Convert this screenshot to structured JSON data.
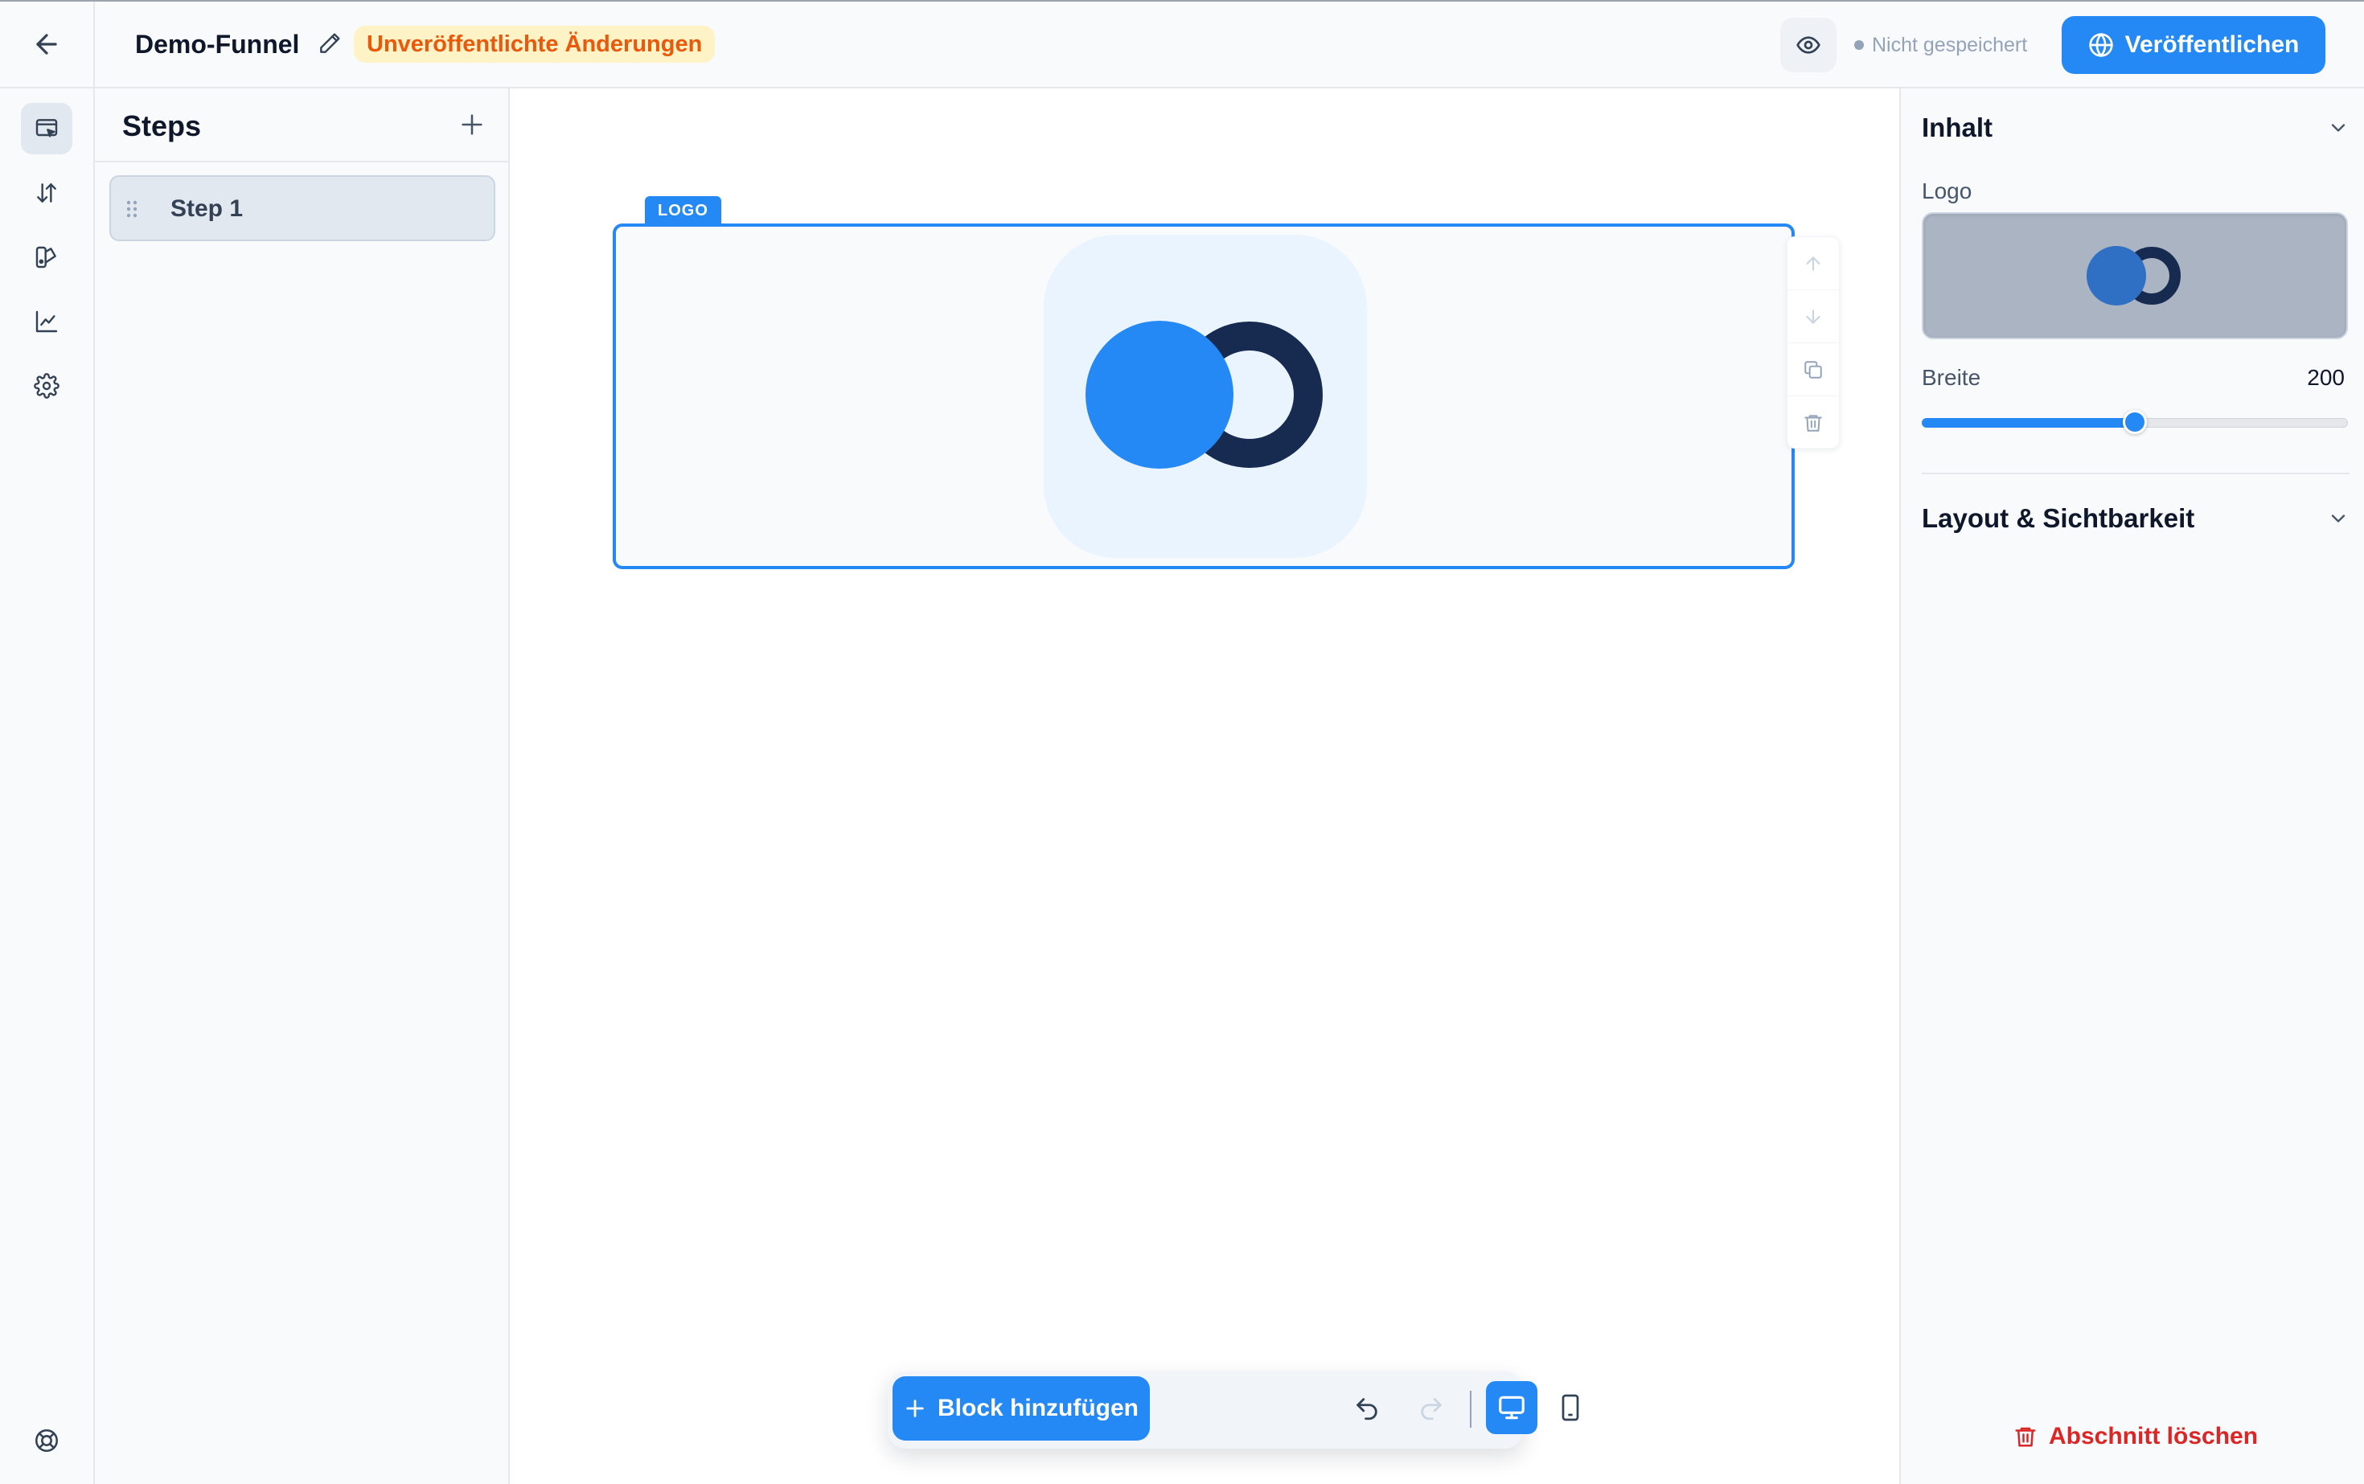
{
  "header": {
    "funnel_name": "Demo-Funnel",
    "unpublished_badge": "Unveröffentlichte Änderungen",
    "save_status": "Nicht gespeichert",
    "publish_label": "Veröffentlichen",
    "icons": {
      "back": "arrow-left-icon",
      "rename": "pencil-icon",
      "preview": "eye-icon",
      "publish": "globe-icon"
    }
  },
  "rail": {
    "items": [
      {
        "icon": "page-editor-icon",
        "active": true
      },
      {
        "icon": "sort-arrows-icon",
        "active": false
      },
      {
        "icon": "design-palette-icon",
        "active": false
      },
      {
        "icon": "analytics-chart-icon",
        "active": false
      },
      {
        "icon": "settings-gear-icon",
        "active": false
      }
    ],
    "bottom_icon": "help-lifebuoy-icon"
  },
  "steps": {
    "title": "Steps",
    "add_icon": "plus-icon",
    "items": [
      {
        "label": "Step 1",
        "selected": true
      }
    ]
  },
  "canvas": {
    "selected_block_tag": "LOGO",
    "block_tools": [
      "arrow-up-icon",
      "arrow-down-icon",
      "duplicate-icon",
      "trash-icon"
    ],
    "toolbar": {
      "add_block_label": "Block hinzufügen",
      "undo_icon": "undo-icon",
      "redo_icon": "redo-icon",
      "device_desktop_icon": "desktop-icon",
      "device_mobile_icon": "mobile-icon",
      "active_device": "desktop"
    }
  },
  "props": {
    "content_section": {
      "title": "Inhalt",
      "logo_label": "Logo",
      "width_label": "Breite",
      "width_value": "200",
      "width_slider_fraction": 0.5
    },
    "layout_section": {
      "title": "Layout & Sichtbarkeit"
    },
    "delete_label": "Abschnitt löschen"
  },
  "colors": {
    "accent": "#2589f5",
    "logo_dark": "#172a4f",
    "badge_bg": "#fef3c7",
    "badge_text": "#ea580c",
    "danger": "#dc2626"
  }
}
